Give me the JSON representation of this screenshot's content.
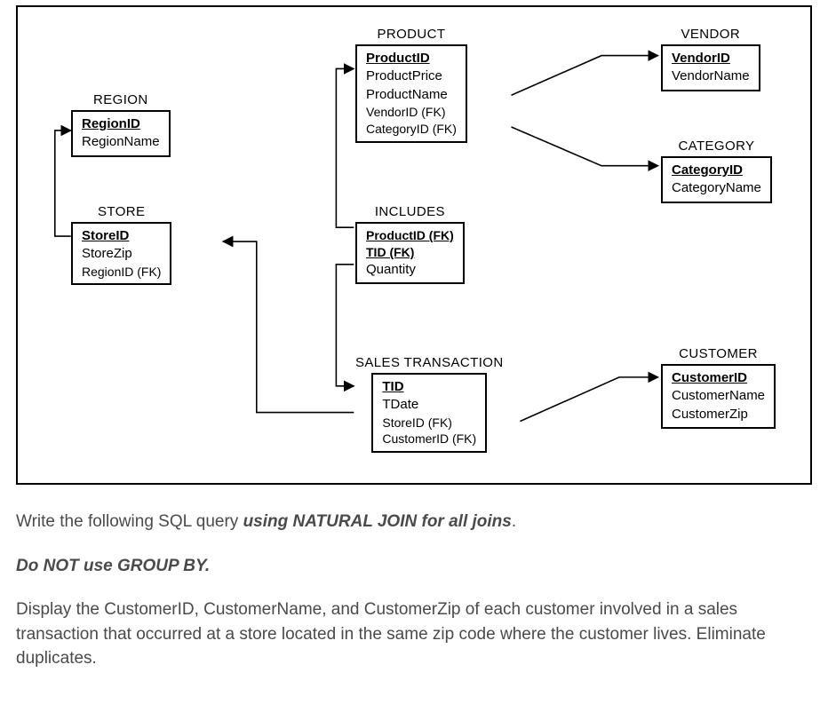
{
  "entities": {
    "region": {
      "title": "REGION",
      "attrs": [
        "RegionID",
        "RegionName"
      ],
      "pk": [
        "RegionID"
      ]
    },
    "store": {
      "title": "STORE",
      "attrs": [
        "StoreID",
        "StoreZip",
        "RegionID  (FK)"
      ],
      "pk": [
        "StoreID"
      ]
    },
    "product": {
      "title": "PRODUCT",
      "attrs": [
        "ProductID",
        "ProductPrice",
        "ProductName",
        "VendorID  (FK)",
        "CategoryID  (FK)"
      ],
      "pk": [
        "ProductID"
      ]
    },
    "includes": {
      "title": "INCLUDES",
      "attrs": [
        "ProductID   (FK)",
        "TID  (FK)",
        "Quantity"
      ],
      "pk": [
        "ProductID",
        "TID"
      ]
    },
    "sales": {
      "title": "SALES TRANSACTION",
      "attrs": [
        "TID",
        "TDate",
        "StoreID  (FK)",
        "CustomerID  (FK)"
      ],
      "pk": [
        "TID"
      ]
    },
    "vendor": {
      "title": "VENDOR",
      "attrs": [
        "VendorID",
        "VendorName"
      ],
      "pk": [
        "VendorID"
      ]
    },
    "category": {
      "title": "CATEGORY",
      "attrs": [
        "CategoryID",
        "CategoryName"
      ],
      "pk": [
        "CategoryID"
      ]
    },
    "customer": {
      "title": "CUSTOMER",
      "attrs": [
        "CustomerID",
        "CustomerName",
        "CustomerZip"
      ],
      "pk": [
        "CustomerID"
      ]
    }
  },
  "question": {
    "line1_a": "Write the following SQL query ",
    "line1_b": "using NATURAL JOIN for all joins",
    "line1_c": ".",
    "line2": "Do NOT use GROUP BY.",
    "line3": "Display the CustomerID, CustomerName, and CustomerZip of each customer involved in a sales transaction that occurred at a store located in the same zip code where the customer lives. Eliminate duplicates."
  }
}
